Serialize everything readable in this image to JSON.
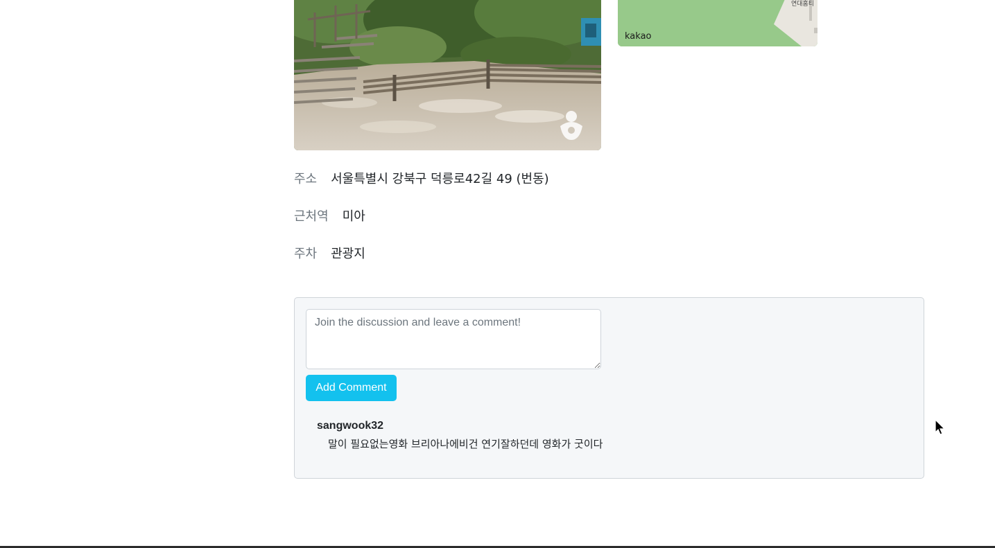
{
  "place": {
    "photo": {
      "alt": "",
      "watermark_icon": "tourism-logo-icon"
    },
    "map": {
      "logo_text": "kakao",
      "street_label": "연대홈티"
    },
    "info": [
      {
        "label": "주소",
        "value": "서울특별시 강북구 덕릉로42길 49 (번동)"
      },
      {
        "label": "근처역",
        "value": "미아"
      },
      {
        "label": "주차",
        "value": "관광지"
      }
    ]
  },
  "comments": {
    "input": {
      "value": "",
      "placeholder": "Join the discussion and leave a comment!"
    },
    "add_button_label": "Add Comment",
    "items": [
      {
        "author": "sangwook32",
        "text": "말이 필요없는영화 브리아나에비건 연기잘하던데 영화가 굿이다"
      }
    ]
  },
  "colors": {
    "button_bg": "#13c1ee",
    "card_bg": "#f5f7f9",
    "map_green": "#97c98a"
  }
}
